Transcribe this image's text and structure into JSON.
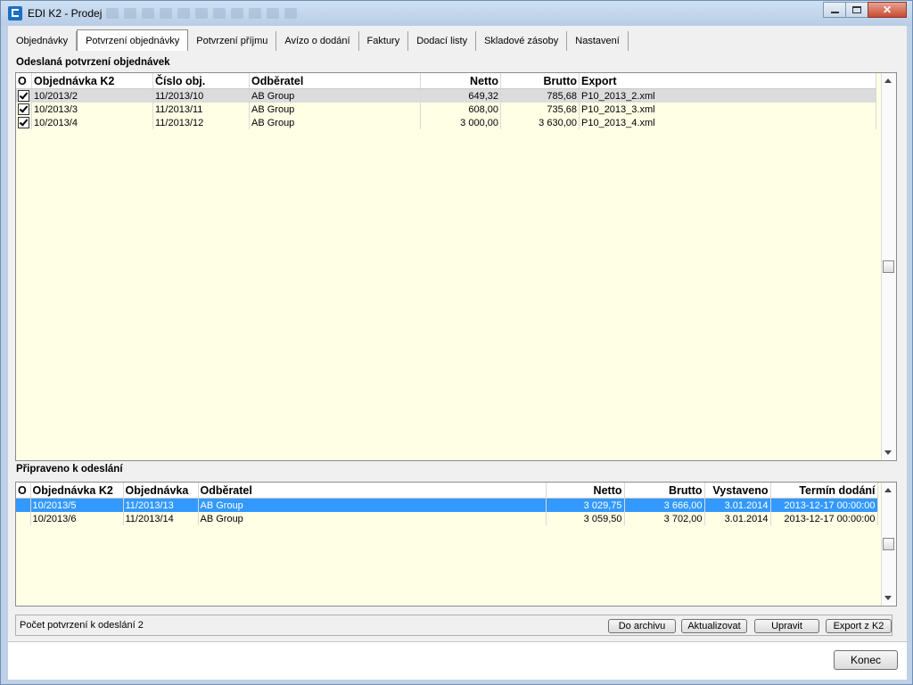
{
  "window": {
    "title": "EDI K2 - Prodej"
  },
  "tabs": [
    {
      "label": "Objednávky",
      "active": false
    },
    {
      "label": "Potvrzení objednávky",
      "active": true
    },
    {
      "label": "Potvrzení příjmu",
      "active": false
    },
    {
      "label": "Avízo o dodání",
      "active": false
    },
    {
      "label": "Faktury",
      "active": false
    },
    {
      "label": "Dodací listy",
      "active": false
    },
    {
      "label": "Skladové zásoby",
      "active": false
    },
    {
      "label": "Nastavení",
      "active": false
    }
  ],
  "sent": {
    "title": "Odeslaná potvrzení objednávek",
    "columns": [
      "O",
      "Objednávka K2",
      "Číslo obj.",
      "Odběratel",
      "Netto",
      "Brutto",
      "Export"
    ],
    "rows": [
      {
        "checked": true,
        "order_k2": "10/2013/2",
        "order_no": "11/2013/10",
        "customer": "AB Group",
        "netto": "649,32",
        "brutto": "785,68",
        "export": "P10_2013_2.xml"
      },
      {
        "checked": true,
        "order_k2": "10/2013/3",
        "order_no": "11/2013/11",
        "customer": "AB Group",
        "netto": "608,00",
        "brutto": "735,68",
        "export": "P10_2013_3.xml"
      },
      {
        "checked": true,
        "order_k2": "10/2013/4",
        "order_no": "11/2013/12",
        "customer": "AB Group",
        "netto": "3 000,00",
        "brutto": "3 630,00",
        "export": "P10_2013_4.xml"
      }
    ]
  },
  "ready": {
    "title": "Připraveno k odeslání",
    "columns": [
      "O",
      "Objednávka K2",
      "Objednávka",
      "Odběratel",
      "Netto",
      "Brutto",
      "Vystaveno",
      "Termín dodání"
    ],
    "rows": [
      {
        "order_k2": "10/2013/5",
        "order": "11/2013/13",
        "customer": "AB Group",
        "netto": "3 029,75",
        "brutto": "3 666,00",
        "issued": "3.01.2014",
        "delivery": "2013-12-17 00:00:00"
      },
      {
        "order_k2": "10/2013/6",
        "order": "11/2013/14",
        "customer": "AB Group",
        "netto": "3 059,50",
        "brutto": "3 702,00",
        "issued": "3.01.2014",
        "delivery": "2013-12-17 00:00:00"
      }
    ]
  },
  "status": {
    "text": "Počet potvrzení k odeslání  2"
  },
  "buttons": {
    "archive": "Do archivu",
    "refresh": "Aktualizovat",
    "edit": "Upravit",
    "export": "Export z K2",
    "close": "Konec"
  }
}
